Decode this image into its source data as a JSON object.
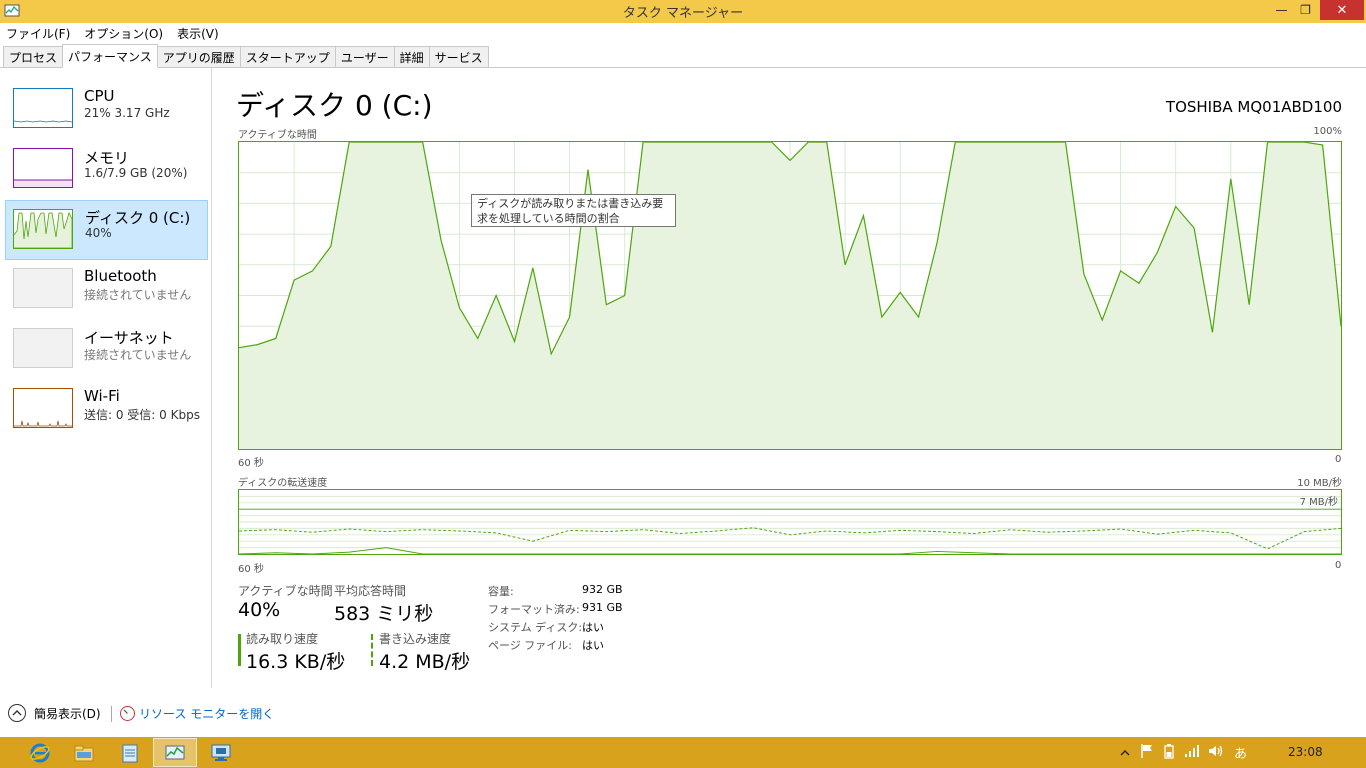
{
  "window": {
    "title": "タスク マネージャー",
    "minimize_glyph": "—",
    "maximize_glyph": "❐",
    "close_glyph": "✕"
  },
  "menu": [
    "ファイル(F)",
    "オプション(O)",
    "表示(V)"
  ],
  "tabs": [
    "プロセス",
    "パフォーマンス",
    "アプリの履歴",
    "スタートアップ",
    "ユーザー",
    "詳細",
    "サービス"
  ],
  "active_tab": "パフォーマンス",
  "sidebar": {
    "items": [
      {
        "title": "CPU",
        "subtitle": "21% 3.17 GHz",
        "color": "#117dbb",
        "selected": false
      },
      {
        "title": "メモリ",
        "subtitle": "1.6/7.9 GB (20%)",
        "color": "#8b12ae",
        "selected": false
      },
      {
        "title": "ディスク 0 (C:)",
        "subtitle": "40%",
        "color": "#4da60c",
        "selected": true
      },
      {
        "title": "Bluetooth",
        "subtitle": "接続されていません",
        "color": "#aaaaaa",
        "selected": false
      },
      {
        "title": "イーサネット",
        "subtitle": "接続されていません",
        "color": "#aaaaaa",
        "selected": false
      },
      {
        "title": "Wi-Fi",
        "subtitle": "送信: 0 受信: 0 Kbps",
        "color": "#a74f01",
        "selected": false
      }
    ]
  },
  "main": {
    "title": "ディスク 0 (C:)",
    "model": "TOSHIBA MQ01ABD100",
    "chart1_label": "アクティブな時間",
    "chart1_max": "100%",
    "chart1_left": "60 秒",
    "chart1_right": "0",
    "chart2_label": "ディスクの転送速度",
    "chart2_max": "10 MB/秒",
    "chart2_inner": "7 MB/秒",
    "chart2_left": "60 秒",
    "chart2_right": "0",
    "tooltip": "ディスクが読み取りまたは書き込み要求を処理している時間の割合"
  },
  "stats": {
    "active_time_label": "アクティブな時間",
    "active_time_value": "40%",
    "avg_response_label": "平均応答時間",
    "avg_response_value": "583 ミリ秒",
    "read_label": "読み取り速度",
    "read_value": "16.3 KB/秒",
    "write_label": "書き込み速度",
    "write_value": "4.2 MB/秒"
  },
  "properties": [
    {
      "label": "容量:",
      "value": "932 GB"
    },
    {
      "label": "フォーマット済み:",
      "value": "931 GB"
    },
    {
      "label": "システム ディスク:",
      "value": "はい"
    },
    {
      "label": "ページ ファイル:",
      "value": "はい"
    }
  ],
  "footer": {
    "fewer_details": "簡易表示(D)",
    "resource_monitor": "リソース モニターを開く"
  },
  "taskbar": {
    "clock": "23:08",
    "ime": "あ"
  },
  "chart_data": [
    {
      "type": "area",
      "title": "アクティブな時間",
      "ylabel": "",
      "xlabel": "",
      "ylim": [
        0,
        100
      ],
      "x": [
        60,
        59,
        58,
        57,
        56,
        55,
        54,
        53,
        52,
        51,
        50,
        49,
        48,
        47,
        46,
        45,
        44,
        43,
        42,
        41,
        40,
        39,
        38,
        37,
        36,
        35,
        34,
        33,
        32,
        31,
        30,
        29,
        28,
        27,
        26,
        25,
        24,
        23,
        22,
        21,
        20,
        19,
        18,
        17,
        16,
        15,
        14,
        13,
        12,
        11,
        10,
        9,
        8,
        7,
        6,
        5,
        4,
        3,
        2,
        1,
        0
      ],
      "series": [
        {
          "values": [
            33,
            34,
            36,
            55,
            58,
            66,
            100,
            100,
            100,
            100,
            100,
            68,
            46,
            36,
            50,
            35,
            59,
            31,
            43,
            91,
            47,
            50,
            100,
            100,
            100,
            100,
            100,
            100,
            100,
            100,
            94,
            100,
            100,
            60,
            76,
            43,
            51,
            43,
            67,
            100,
            100,
            100,
            100,
            100,
            100,
            100,
            57,
            42,
            58,
            54,
            64,
            79,
            72,
            38,
            88,
            47,
            100,
            100,
            100,
            99,
            40
          ]
        }
      ]
    },
    {
      "type": "line",
      "title": "ディスクの転送速度",
      "ylim": [
        0,
        10
      ],
      "x": [
        60,
        58,
        56,
        54,
        52,
        50,
        48,
        46,
        44,
        42,
        40,
        38,
        36,
        34,
        32,
        30,
        28,
        26,
        24,
        22,
        20,
        18,
        16,
        14,
        12,
        10,
        8,
        6,
        4,
        2,
        0
      ],
      "series": [
        {
          "values": [
            3.6,
            3.8,
            3.4,
            3.9,
            3.5,
            3.8,
            3.6,
            3.3,
            2.0,
            3.7,
            3.5,
            3.8,
            3.2,
            3.6,
            4.1,
            3.0,
            3.6,
            3.3,
            3.7,
            3.5,
            3.2,
            3.8,
            3.4,
            3.6,
            3.9,
            3.1,
            3.7,
            3.3,
            0.8,
            3.5,
            4.0
          ]
        },
        {
          "values": [
            0.0,
            0.2,
            0.0,
            0.3,
            1.0,
            0.0,
            0.0,
            0.0,
            0.0,
            0.0,
            0.0,
            0.0,
            0.0,
            0.0,
            0.0,
            0.0,
            0.0,
            0.0,
            0.0,
            0.4,
            0.2,
            0.0,
            0.0,
            0.0,
            0.0,
            0.0,
            0.0,
            0.0,
            0.0,
            0.0,
            0.0
          ]
        }
      ]
    }
  ]
}
